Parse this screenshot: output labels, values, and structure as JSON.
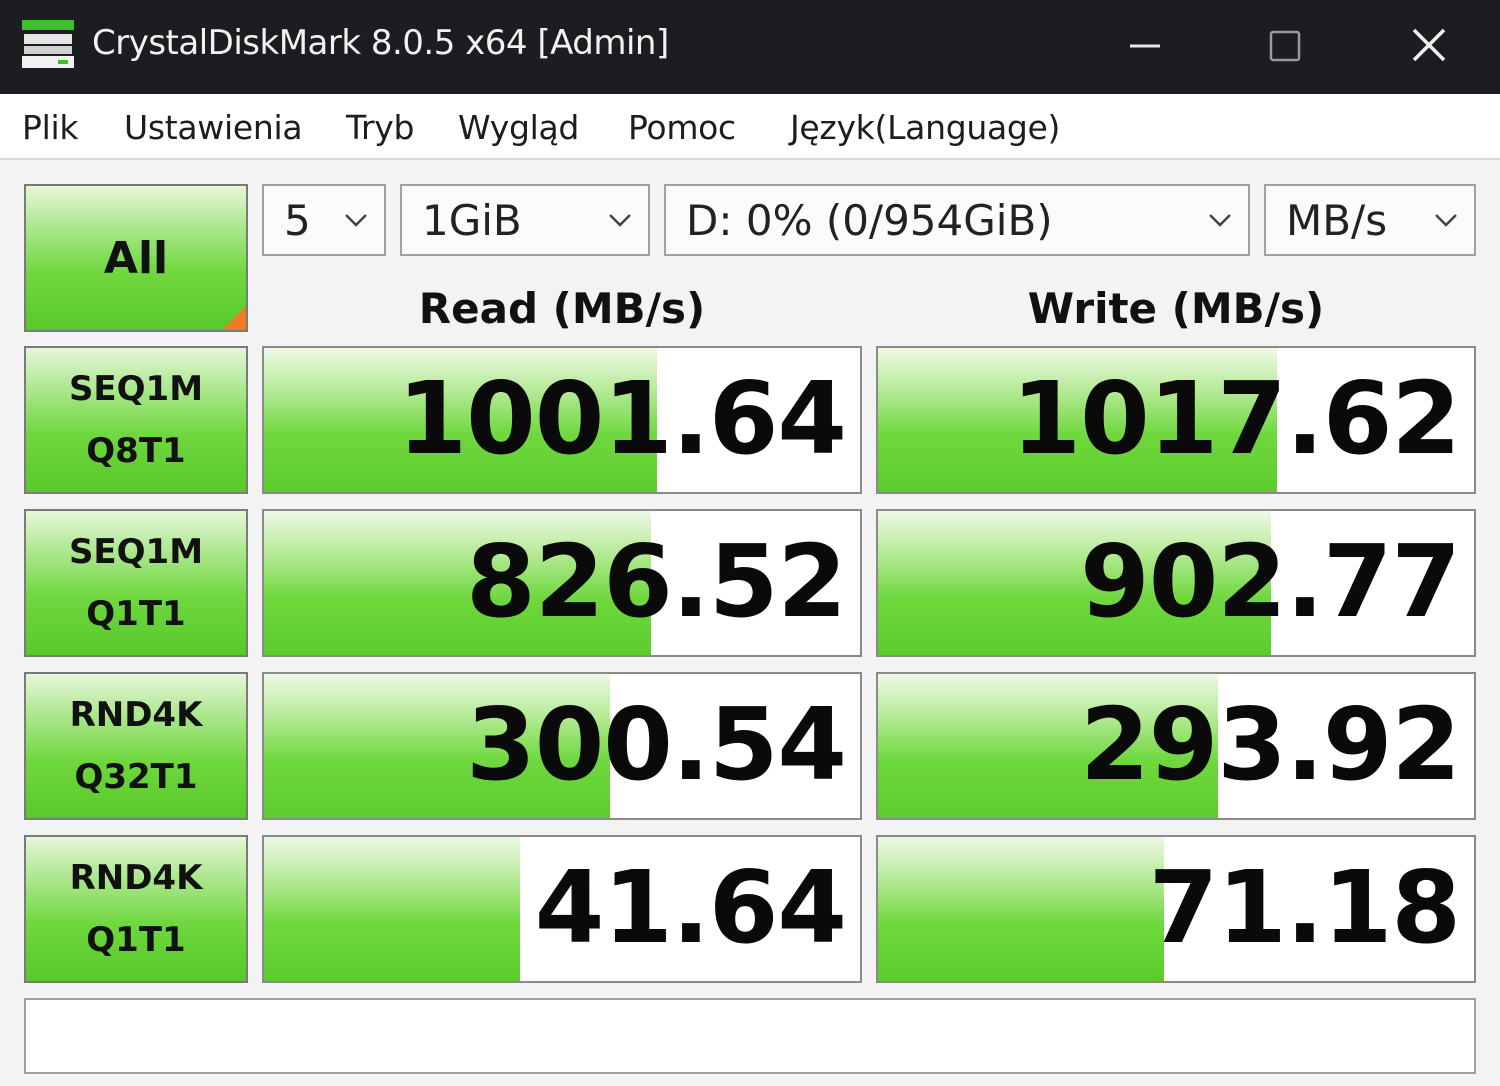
{
  "window": {
    "title": "CrystalDiskMark 8.0.5 x64 [Admin]"
  },
  "menu": [
    "Plik",
    "Ustawienia",
    "Tryb",
    "Wygląd",
    "Pomoc",
    "Język(Language)"
  ],
  "controls": {
    "all_label": "All",
    "count": "5",
    "size": "1GiB",
    "drive": "D: 0% (0/954GiB)",
    "unit": "MB/s"
  },
  "headers": {
    "read": "Read (MB/s)",
    "write": "Write (MB/s)"
  },
  "tests": [
    {
      "line1": "SEQ1M",
      "line2": "Q8T1",
      "read": "1001.64",
      "write": "1017.62",
      "read_fill": 0.66,
      "write_fill": 0.67
    },
    {
      "line1": "SEQ1M",
      "line2": "Q1T1",
      "read": "826.52",
      "write": "902.77",
      "read_fill": 0.65,
      "write_fill": 0.66
    },
    {
      "line1": "RND4K",
      "line2": "Q32T1",
      "read": "300.54",
      "write": "293.92",
      "read_fill": 0.58,
      "write_fill": 0.57
    },
    {
      "line1": "RND4K",
      "line2": "Q1T1",
      "read": "41.64",
      "write": "71.18",
      "read_fill": 0.43,
      "write_fill": 0.48
    }
  ],
  "comment": "",
  "colors": {
    "accent_green": "#6fd83e",
    "corner_orange": "#f07a28",
    "titlebar": "#1b1d21"
  },
  "icons": {
    "app": "disk-drive-icon",
    "minimize": "minimize-icon",
    "maximize": "maximize-icon",
    "close": "close-icon",
    "dropdown": "chevron-down-icon"
  }
}
